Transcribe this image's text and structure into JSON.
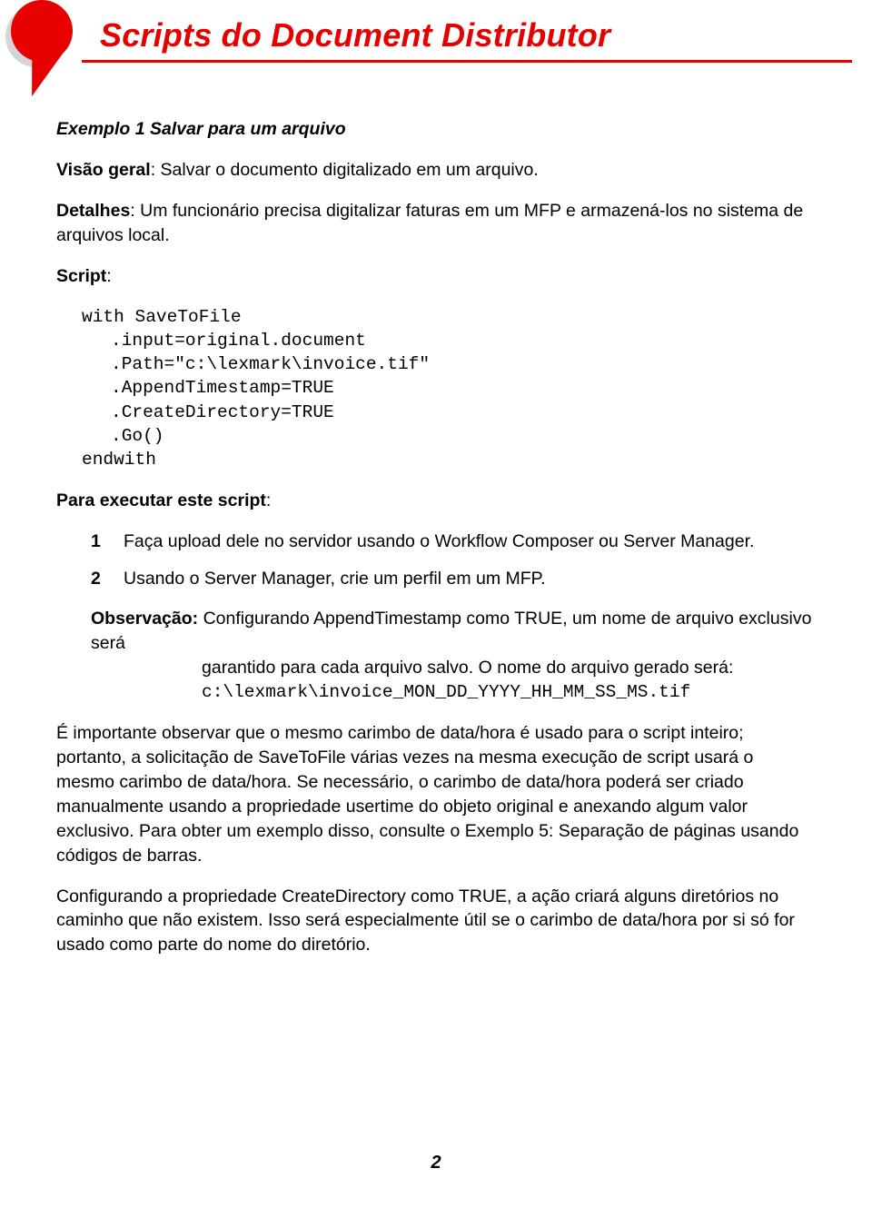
{
  "title": "Scripts do Document Distributor",
  "example_title": "Exemplo 1 Salvar para um arquivo",
  "overview_label": "Visão geral",
  "overview_text": ": Salvar o documento digitalizado em um arquivo.",
  "details_label": "Detalhes",
  "details_text": ": Um funcionário precisa digitalizar faturas em um MFP e armazená-los no sistema de arquivos local.",
  "script_label": "Script",
  "script_colon": ":",
  "code": {
    "l1": "with SaveToFile",
    "l2": ".input=original.document",
    "l3": ".Path=\"c:\\lexmark\\invoice.tif\"",
    "l4": ".AppendTimestamp=TRUE",
    "l5": ".CreateDirectory=TRUE",
    "l6": ".Go()",
    "l7": "endwith"
  },
  "run_label": "Para executar este script",
  "run_colon": ":",
  "steps": [
    {
      "num": "1",
      "text": "Faça upload dele no servidor usando o Workflow Composer ou Server Manager."
    },
    {
      "num": "2",
      "text": "Usando o Server Manager, crie um perfil em um MFP."
    }
  ],
  "note_label": "Observação:",
  "note_line1": " Configurando AppendTimestamp como TRUE, um nome de arquivo exclusivo será",
  "note_line2": "garantido para cada arquivo salvo. O nome do arquivo gerado será:",
  "note_code": "c:\\lexmark\\invoice_MON_DD_YYYY_HH_MM_SS_MS.tif",
  "para1": "É importante observar que o mesmo carimbo de data/hora é usado para o script inteiro; portanto, a solicitação de SaveToFile várias vezes na mesma execução de script usará o mesmo carimbo de data/hora. Se necessário, o carimbo de data/hora poderá ser criado manualmente usando a propriedade usertime do objeto original e anexando algum valor exclusivo. Para obter um exemplo disso, consulte o Exemplo 5: Separação de páginas usando códigos de barras.",
  "para2": "Configurando a propriedade CreateDirectory como TRUE, a ação criará alguns diretórios no caminho que não existem. Isso será especialmente útil se o carimbo de data/hora por si só for usado como parte do nome do diretório.",
  "page_number": "2"
}
